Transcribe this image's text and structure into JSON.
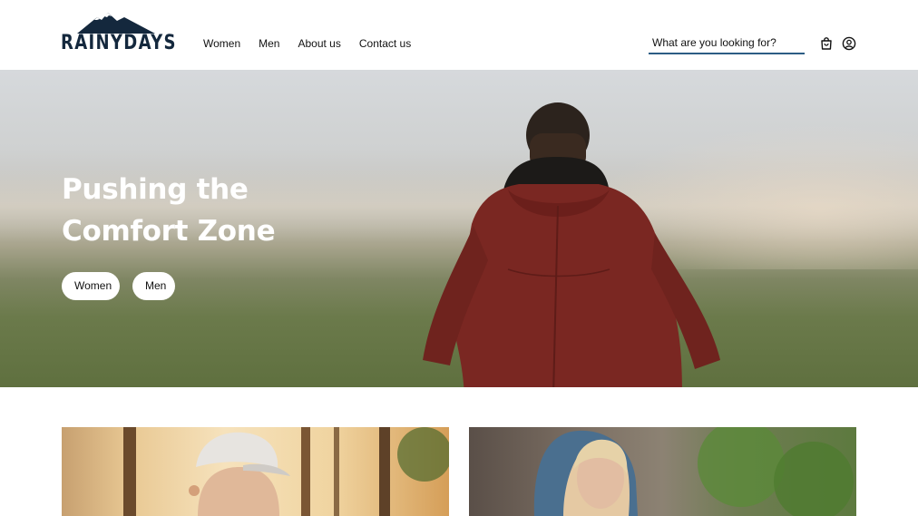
{
  "header": {
    "logo_text": "RAINYDAYS",
    "nav": [
      "Women",
      "Men",
      "About us",
      "Contact us"
    ],
    "search_placeholder": "What are you looking for?",
    "icons": [
      "shopping-bag-icon",
      "user-icon"
    ]
  },
  "hero": {
    "title_line1": "Pushing the",
    "title_line2": "Comfort Zone",
    "buttons": [
      "Women",
      "Men"
    ]
  },
  "colors": {
    "brand": "#14283d",
    "search_underline": "#2c5d84",
    "jacket": "#7a2722"
  }
}
